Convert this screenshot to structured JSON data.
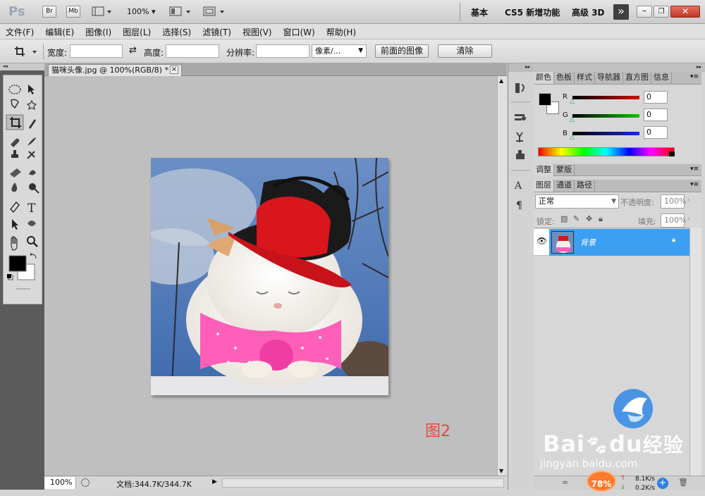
{
  "app": {
    "logo": "Ps",
    "quick": {
      "br": "Br",
      "mb": "Mb",
      "zoom": "100%"
    },
    "workspaces": [
      "基本",
      "CS5 新增功能",
      "高级 3D"
    ],
    "more": "»"
  },
  "menu": [
    "文件(F)",
    "编辑(E)",
    "图像(I)",
    "图层(L)",
    "选择(S)",
    "滤镜(T)",
    "视图(V)",
    "窗口(W)",
    "帮助(H)"
  ],
  "options": {
    "width_label": "宽度:",
    "height_label": "高度:",
    "res_label": "分辨率:",
    "unit": "像素/...",
    "front_image": "前面的图像",
    "clear": "清除",
    "width_value": "",
    "height_value": "",
    "res_value": ""
  },
  "document": {
    "tab_title": "猫咪头像.jpg @ 100%(RGB/8) *",
    "tab_close": "×",
    "caption": "图2",
    "zoom": "100%",
    "doc_info": "文档:344.7K/344.7K"
  },
  "color_panel": {
    "tabs": [
      "颜色",
      "色板",
      "样式",
      "导航器",
      "直方图",
      "信息"
    ],
    "channels": [
      {
        "label": "R",
        "value": "0"
      },
      {
        "label": "G",
        "value": "0"
      },
      {
        "label": "B",
        "value": "0"
      }
    ]
  },
  "adjust_panel": {
    "tabs": [
      "调整",
      "蒙版"
    ]
  },
  "layers_panel": {
    "tabs": [
      "图层",
      "通道",
      "路径"
    ],
    "blend_mode": "正常",
    "opacity_label": "不透明度:",
    "opacity": "100%",
    "lock_label": "锁定:",
    "fill_label": "填充:",
    "fill": "100%",
    "layer_name": "背景"
  },
  "watermark": {
    "brand": "Bai",
    "brand2": "du",
    "brand_cn": "经验",
    "url": "jingyan.baidu.com"
  },
  "netmeter": {
    "percent": "78%",
    "up": "8.1K/s",
    "down": "0.2K/s"
  },
  "colors": {
    "accent": "#3c9ff2",
    "caption": "#e8463f",
    "hat": "#d8161c",
    "bow": "#ff5fb8"
  }
}
